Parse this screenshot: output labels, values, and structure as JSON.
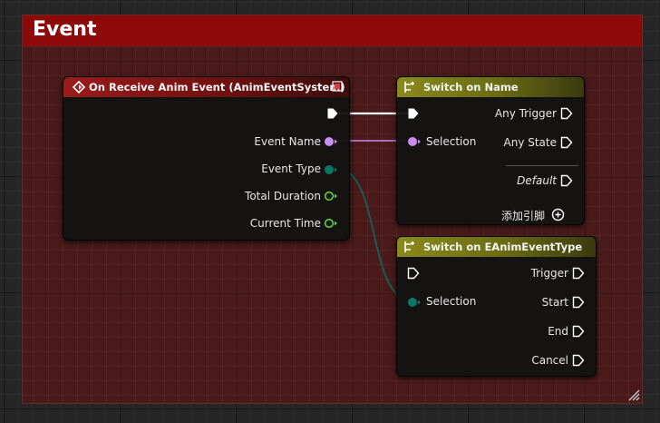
{
  "comment": {
    "title": "Event"
  },
  "event_node": {
    "title": "On Receive Anim Event (AnimEventSystem)",
    "header_color": "#8a1616",
    "outputs": {
      "event_name": "Event Name",
      "event_type": "Event Type",
      "total_duration": "Total Duration",
      "current_time": "Current Time"
    }
  },
  "switch_name_node": {
    "title": "Switch on Name",
    "header_color": "#7b7b18",
    "input_selection": "Selection",
    "outputs": {
      "any_trigger": "Any Trigger",
      "any_state": "Any State",
      "default": "Default"
    },
    "add_pin": "添加引脚"
  },
  "switch_enum_node": {
    "title": "Switch on EAnimEventType",
    "header_color": "#7b7b18",
    "input_selection": "Selection",
    "outputs": {
      "trigger": "Trigger",
      "start": "Start",
      "end": "End",
      "cancel": "Cancel"
    }
  },
  "colors": {
    "exec": "#ffffff",
    "name_pin": "#c98cf0",
    "enum_pin": "#0b7566",
    "float_pin": "#5fd43a"
  },
  "icons": {
    "event": "event-diamond-icon",
    "switch": "switch-icon",
    "delegate": "delegate-square-icon",
    "add": "add-pin-plus-icon",
    "resize": "resize-grip-icon"
  }
}
